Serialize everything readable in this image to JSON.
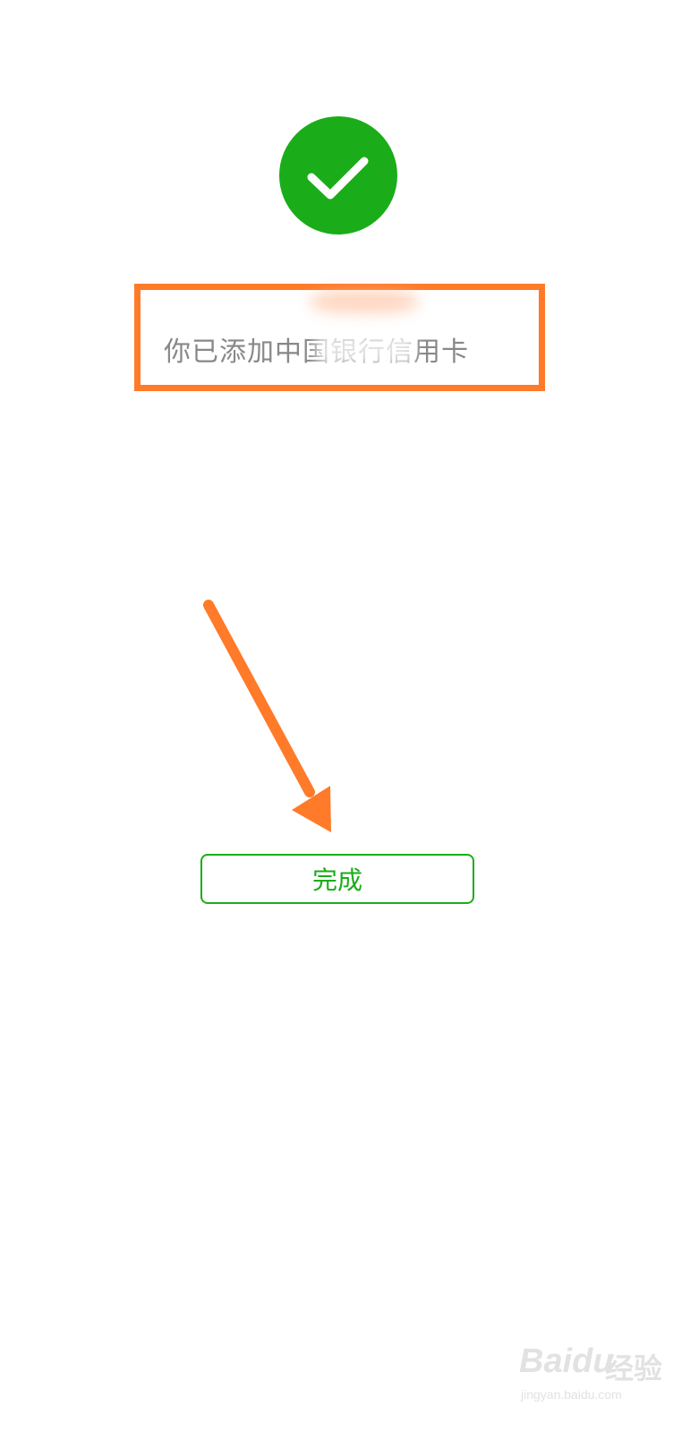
{
  "success": {
    "icon": "checkmark-icon",
    "color": "#1aad19"
  },
  "message": {
    "text": "你已添加中国银行信用卡"
  },
  "annotation": {
    "box_color": "#ff7a29",
    "arrow_color": "#ff7a29"
  },
  "done_button": {
    "label": "完成",
    "color": "#1aad19"
  },
  "watermark": {
    "brand": "Baidu",
    "brand_cn": "经验",
    "url": "jingyan.baidu.com"
  }
}
